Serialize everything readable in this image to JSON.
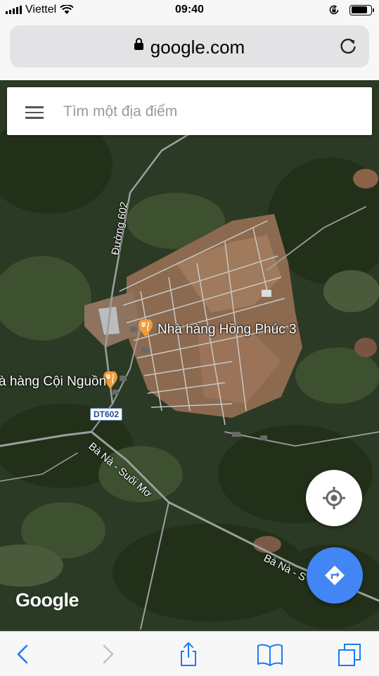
{
  "status_bar": {
    "carrier": "Viettel",
    "time": "09:40",
    "battery_level": 0.85,
    "icons": [
      "signal-icon",
      "wifi-icon",
      "orientation-lock-icon",
      "battery-icon"
    ]
  },
  "browser": {
    "url": "google.com",
    "icons": [
      "lock-icon",
      "reload-icon"
    ]
  },
  "map": {
    "search": {
      "placeholder": "Tìm một địa điểm"
    },
    "places": [
      {
        "name": "Nhà hàng Hồng Phúc 3",
        "icon": "restaurant-icon"
      },
      {
        "name": "à hàng Cội Nguồn",
        "icon": "restaurant-icon"
      }
    ],
    "roads": {
      "duong_602": "Đường 602",
      "shield": "DT602",
      "ba_na_suoi_mo": "Bà Nà - Suối Mơ",
      "ba_na_s": "Bà Nà - S"
    },
    "watermark": "Google",
    "buttons": [
      "my-location-button",
      "directions-button"
    ],
    "colors": {
      "directions": "#4285f4",
      "shield_text": "#1d4f8c"
    }
  },
  "toolbar": {
    "items": [
      "back",
      "forward",
      "share",
      "bookmarks",
      "tabs"
    ],
    "tint": "#1a7cf5"
  }
}
